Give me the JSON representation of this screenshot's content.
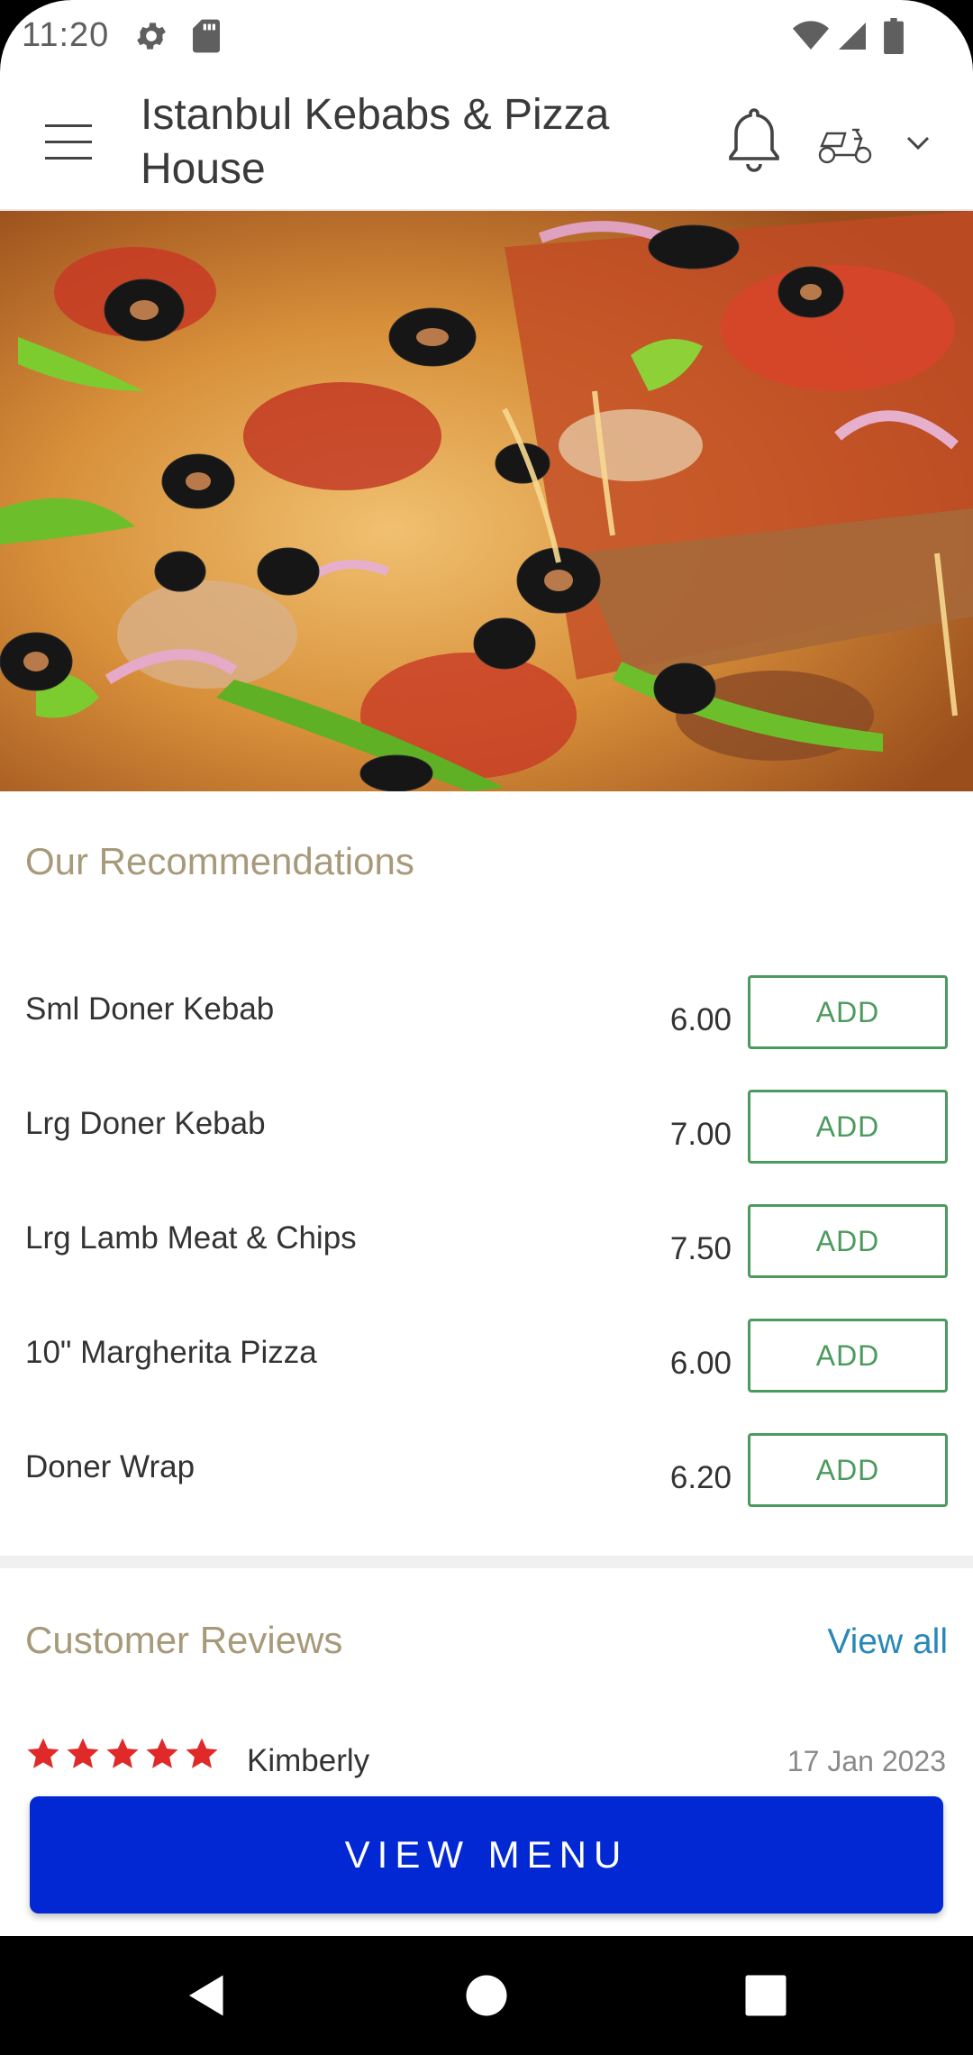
{
  "status_bar": {
    "time": "11:20",
    "icons": [
      "gear-icon",
      "sd-card-icon",
      "wifi-icon",
      "signal-icon",
      "battery-icon"
    ]
  },
  "app_bar": {
    "title": "Istanbul Kebabs & Pizza House",
    "icons": [
      "menu-icon",
      "bell-icon",
      "scooter-icon",
      "chevron-down-icon"
    ]
  },
  "hero": {
    "image": "pizza-photo"
  },
  "recommendations": {
    "title": "Our Recommendations",
    "add_label": "ADD",
    "items": [
      {
        "name": "Sml Doner Kebab",
        "price": "6.00"
      },
      {
        "name": "Lrg Doner Kebab",
        "price": "7.00"
      },
      {
        "name": "Lrg Lamb Meat & Chips",
        "price": "7.50"
      },
      {
        "name": "10\" Margherita Pizza",
        "price": "6.00"
      },
      {
        "name": "Doner Wrap",
        "price": "6.20"
      }
    ]
  },
  "reviews": {
    "title": "Customer Reviews",
    "view_all": "View all",
    "items": [
      {
        "rating": 5,
        "name": "Kimberly",
        "date": "17 Jan 2023"
      }
    ]
  },
  "view_menu_button": "VIEW MENU",
  "colors": {
    "accent_green": "#4c9a5e",
    "section_title": "#a79a7a",
    "link_blue": "#2a88b8",
    "button_blue": "#0228d4",
    "star_red": "#e02a2a"
  },
  "nav_bar": {
    "icons": [
      "back-icon",
      "home-icon",
      "recents-icon"
    ]
  }
}
